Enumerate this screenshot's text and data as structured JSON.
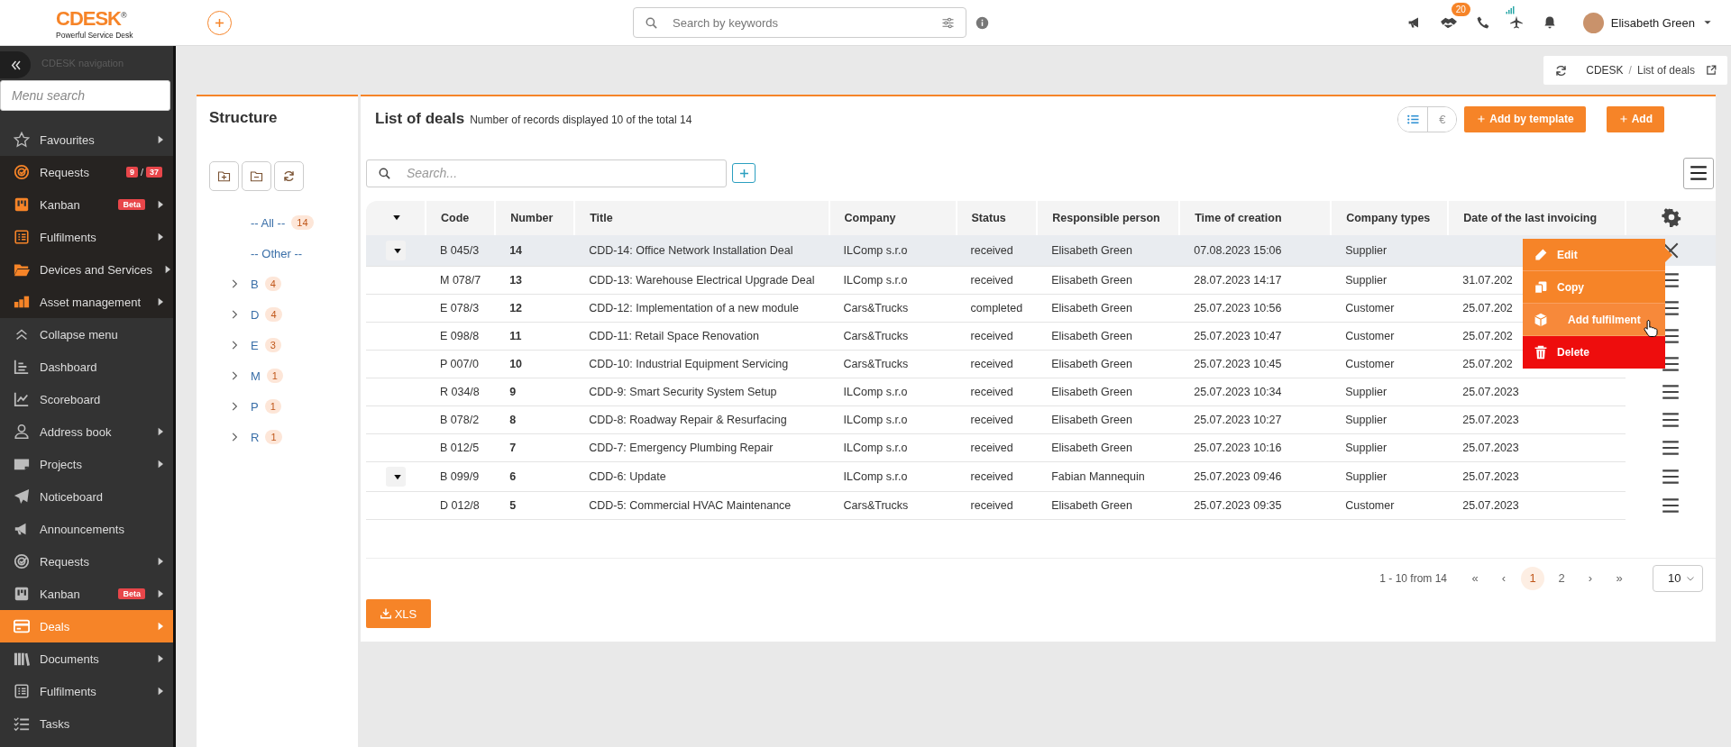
{
  "topbar": {
    "logo": "CDESK",
    "logo_mark": "®",
    "tagline": "Powerful Service Desk",
    "search": {
      "placeholder": "Search by keywords"
    },
    "notifications_count": "20",
    "user": "Elisabeth Green"
  },
  "sidebar": {
    "title": "CDESK navigation",
    "search": {
      "placeholder": "Menu search"
    },
    "items": [
      {
        "label": "Favourites",
        "pinned": false,
        "has_submenu": true,
        "selected": false
      },
      {
        "label": "Requests",
        "pinned": true,
        "has_submenu": false,
        "selected": false,
        "counts": {
          "open": "9",
          "separator": "/",
          "total": "37"
        }
      },
      {
        "label": "Kanban",
        "pinned": true,
        "has_submenu": true,
        "selected": false,
        "tag": "Beta"
      },
      {
        "label": "Fulfilments",
        "pinned": true,
        "has_submenu": true,
        "selected": false
      },
      {
        "label": "Devices and Services",
        "pinned": true,
        "has_submenu": true,
        "selected": false
      },
      {
        "label": "Asset management",
        "pinned": true,
        "has_submenu": true,
        "selected": false
      },
      {
        "label": "Collapse menu",
        "pinned": false,
        "has_submenu": false,
        "selected": false
      },
      {
        "label": "Dashboard",
        "pinned": false,
        "has_submenu": false,
        "selected": false
      },
      {
        "label": "Scoreboard",
        "pinned": false,
        "has_submenu": false,
        "selected": false
      },
      {
        "label": "Address book",
        "pinned": false,
        "has_submenu": true,
        "selected": false
      },
      {
        "label": "Projects",
        "pinned": false,
        "has_submenu": true,
        "selected": false
      },
      {
        "label": "Noticeboard",
        "pinned": false,
        "has_submenu": false,
        "selected": false
      },
      {
        "label": "Announcements",
        "pinned": false,
        "has_submenu": false,
        "selected": false
      },
      {
        "label": "Requests",
        "pinned": false,
        "has_submenu": true,
        "selected": false
      },
      {
        "label": "Kanban",
        "pinned": false,
        "has_submenu": true,
        "selected": false,
        "tag": "Beta"
      },
      {
        "label": "Deals",
        "pinned": false,
        "has_submenu": true,
        "selected": true
      },
      {
        "label": "Documents",
        "pinned": false,
        "has_submenu": true,
        "selected": false
      },
      {
        "label": "Fulfilments",
        "pinned": false,
        "has_submenu": true,
        "selected": false
      },
      {
        "label": "Tasks",
        "pinned": false,
        "has_submenu": false,
        "selected": false
      }
    ]
  },
  "breadcrumb": {
    "items": [
      "CDESK",
      "List of deals"
    ],
    "separator": "/"
  },
  "structure": {
    "title": "Structure",
    "tree": [
      {
        "label": "-- All --",
        "count": "14",
        "expandable": false
      },
      {
        "label": "-- Other --",
        "expandable": false
      },
      {
        "label": "B",
        "count": "4",
        "expandable": true,
        "expanded": false
      },
      {
        "label": "D",
        "count": "4",
        "expandable": true,
        "expanded": false
      },
      {
        "label": "E",
        "count": "3",
        "expandable": true,
        "expanded": false
      },
      {
        "label": "M",
        "count": "1",
        "expandable": true,
        "expanded": false
      },
      {
        "label": "P",
        "count": "1",
        "expandable": true,
        "expanded": false
      },
      {
        "label": "R",
        "count": "1",
        "expandable": true,
        "expanded": false
      }
    ]
  },
  "deals": {
    "title": "List of deals",
    "subtitle": "Number of records displayed 10 of the total 14",
    "currency_button": "€",
    "buttons": [
      "Add by template",
      "Add"
    ],
    "search": {
      "placeholder": "Search..."
    },
    "table": {
      "columns": [
        "Code",
        "Number",
        "Title",
        "Company",
        "Status",
        "Responsible person",
        "Time of creation",
        "Company types",
        "Date of the last invoicing"
      ],
      "rows": [
        {
          "toggle": true,
          "selected": true,
          "menu_open": true,
          "code": "B 045/3",
          "number": "14",
          "title": "CDD-14: Office Network Installation Deal",
          "company": "ILComp s.r.o",
          "status": "received",
          "person": "Elisabeth Green",
          "created": "07.08.2023 15:06",
          "company_type": "Supplier"
        },
        {
          "toggle": false,
          "selected": false,
          "menu_open": false,
          "code": "M 078/7",
          "number": "13",
          "title": "CDD-13: Warehouse Electrical Upgrade Deal",
          "company": "ILComp s.r.o",
          "status": "received",
          "person": "Elisabeth Green",
          "created": "28.07.2023 14:17",
          "company_type": "Supplier",
          "last_invoice": "31.07.202"
        },
        {
          "toggle": false,
          "selected": false,
          "menu_open": false,
          "code": "E 078/3",
          "number": "12",
          "title": "CDD-12: Implementation of a new module",
          "company": "Cars&Trucks",
          "status": "completed",
          "person": "Elisabeth Green",
          "created": "25.07.2023 10:56",
          "company_type": "Customer",
          "last_invoice": "25.07.202"
        },
        {
          "toggle": false,
          "selected": false,
          "menu_open": false,
          "code": "E 098/8",
          "number": "11",
          "title": "CDD-11: Retail Space Renovation",
          "company": "Cars&Trucks",
          "status": "received",
          "person": "Elisabeth Green",
          "created": "25.07.2023 10:47",
          "company_type": "Customer",
          "last_invoice": "25.07.202"
        },
        {
          "toggle": false,
          "selected": false,
          "menu_open": false,
          "code": "P 007/0",
          "number": "10",
          "title": "CDD-10: Industrial Equipment Servicing",
          "company": "Cars&Trucks",
          "status": "received",
          "person": "Elisabeth Green",
          "created": "25.07.2023 10:45",
          "company_type": "Customer",
          "last_invoice": "25.07.202"
        },
        {
          "toggle": false,
          "selected": false,
          "menu_open": false,
          "code": "R 034/8",
          "number": "9",
          "title": "CDD-9: Smart Security System Setup",
          "company": "ILComp s.r.o",
          "status": "received",
          "person": "Elisabeth Green",
          "created": "25.07.2023 10:34",
          "company_type": "Supplier",
          "last_invoice": "25.07.2023"
        },
        {
          "toggle": false,
          "selected": false,
          "menu_open": false,
          "code": "B 078/2",
          "number": "8",
          "title": "CDD-8: Roadway Repair & Resurfacing",
          "company": "ILComp s.r.o",
          "status": "received",
          "person": "Elisabeth Green",
          "created": "25.07.2023 10:27",
          "company_type": "Supplier",
          "last_invoice": "25.07.2023"
        },
        {
          "toggle": false,
          "selected": false,
          "menu_open": false,
          "code": "B 012/5",
          "number": "7",
          "title": "CDD-7: Emergency Plumbing Repair",
          "company": "ILComp s.r.o",
          "status": "received",
          "person": "Elisabeth Green",
          "created": "25.07.2023 10:16",
          "company_type": "Supplier",
          "last_invoice": "25.07.2023"
        },
        {
          "toggle": true,
          "selected": false,
          "menu_open": false,
          "code": "B 099/9",
          "number": "6",
          "title": "CDD-6: Update",
          "company": "ILComp s.r.o",
          "status": "received",
          "person": "Fabian Mannequin",
          "created": "25.07.2023 09:46",
          "company_type": "Supplier",
          "last_invoice": "25.07.2023"
        },
        {
          "toggle": false,
          "selected": false,
          "menu_open": false,
          "code": "D 012/8",
          "number": "5",
          "title": "CDD-5: Commercial HVAC Maintenance",
          "company": "Cars&Trucks",
          "status": "received",
          "person": "Elisabeth Green",
          "created": "25.07.2023 09:35",
          "company_type": "Customer",
          "last_invoice": "25.07.2023"
        }
      ]
    },
    "row_menu": [
      {
        "label": "Edit",
        "kind": "edit",
        "hovered": false
      },
      {
        "label": "Copy",
        "kind": "copy",
        "hovered": false
      },
      {
        "label": "Add fulfilment",
        "kind": "add",
        "hovered": true
      },
      {
        "label": "Delete",
        "kind": "delete",
        "hovered": false
      }
    ],
    "pagination": {
      "summary": "1 - 10 from 14",
      "first": "«",
      "prev": "‹",
      "next": "›",
      "last": "»",
      "pages": [
        {
          "label": "1",
          "selected": true
        },
        {
          "label": "2",
          "selected": false
        }
      ],
      "page_size": "10"
    },
    "export_button": "XLS"
  }
}
